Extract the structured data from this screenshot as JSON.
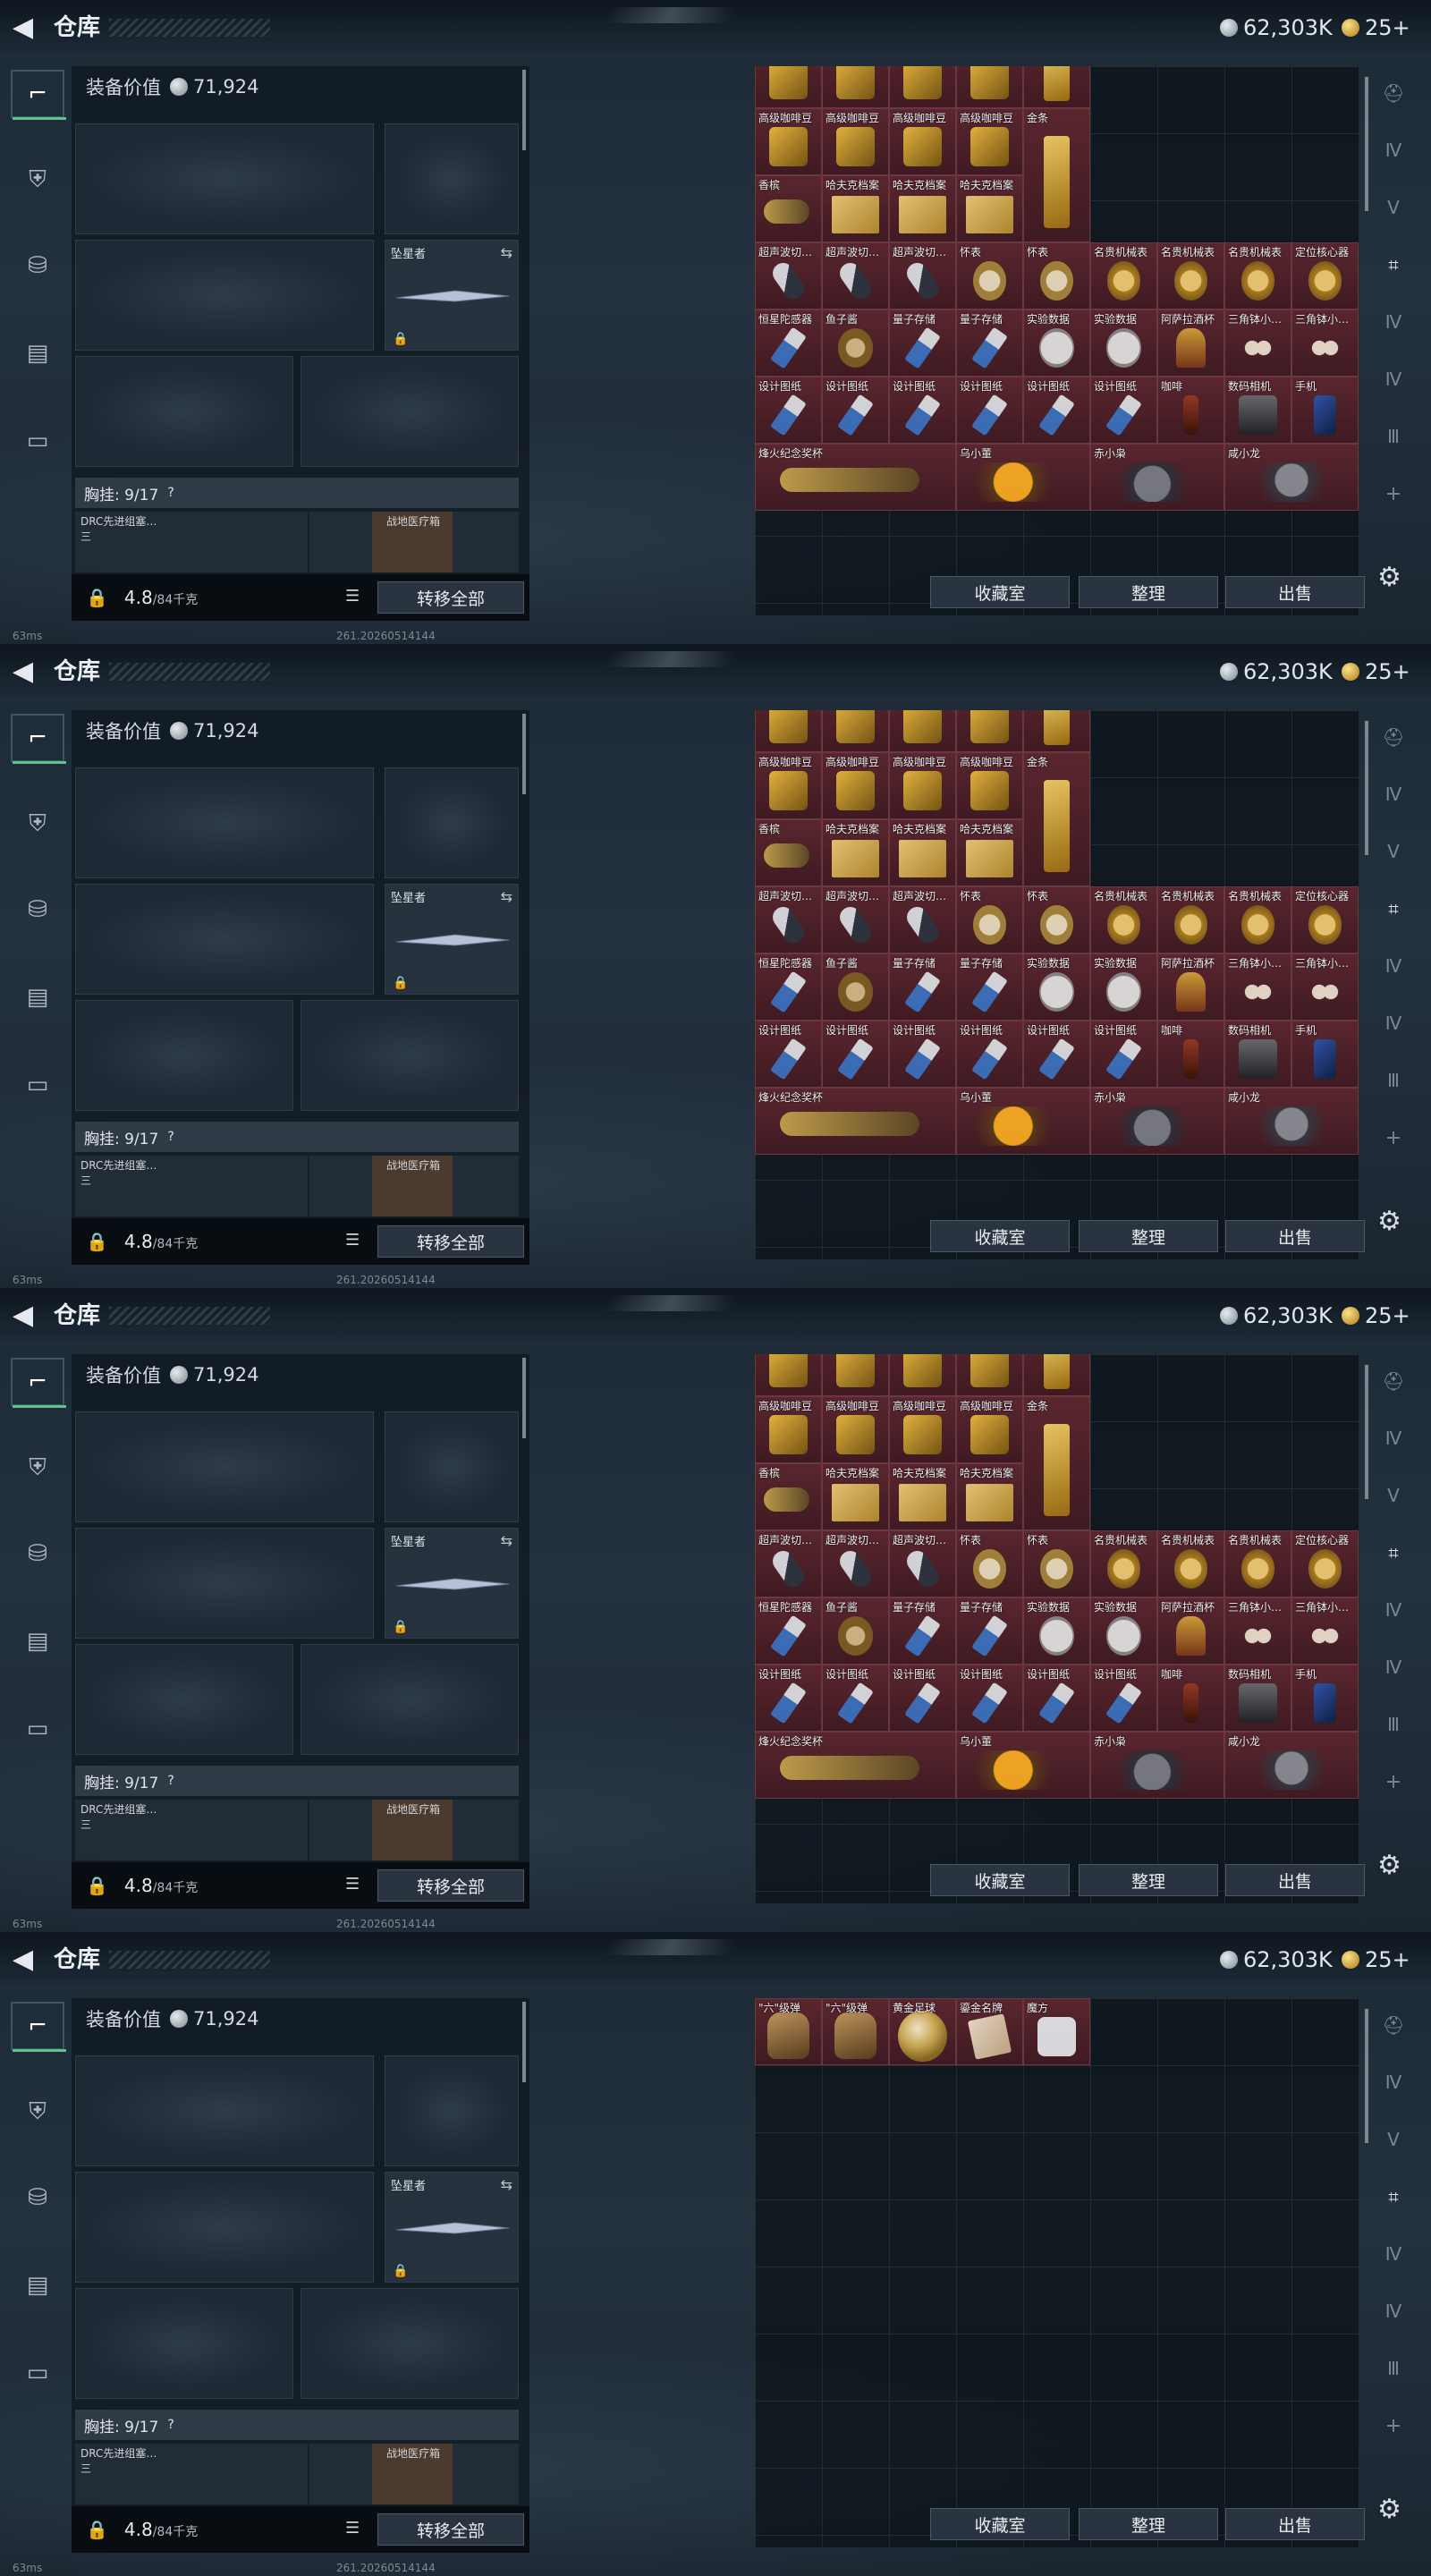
{
  "topbar": {
    "back_icon": "back-arrow-icon",
    "title": "仓库",
    "currency_silver": "62,303K",
    "currency_gold": "25+"
  },
  "equipment": {
    "value_label": "装备价值",
    "value": "71,924",
    "melee_name": "坠星者",
    "chest_label": "胸挂: 9/17",
    "chest_help": "?",
    "pouch1_line1": "DRC先进组塞…",
    "pouch1_line2": "三",
    "pouch2": "战地医疗箱",
    "weight": "4.8",
    "weight_max": "/84千克",
    "transfer_all": "转移全部"
  },
  "footer": {
    "ping": "63ms",
    "build": "261.20260514144"
  },
  "actions": {
    "collection": "收藏室",
    "sort": "整理",
    "sell": "出售"
  },
  "colors": {
    "item_bg": "#5a262e",
    "accent_green": "#5cc48a"
  },
  "sidebar_icons": [
    "weapon-icon",
    "armor-icon",
    "backpack-icon",
    "clipboard-icon",
    "briefcase-icon"
  ],
  "right_icons": [
    "helmet-icon",
    "tab-iv-icon",
    "tab-v-icon",
    "scan-icon",
    "tab-iv-b-icon",
    "tab-iv-c-icon",
    "tab-iii-icon",
    "plus-icon"
  ],
  "stash_page_a": [
    {
      "name": "高级咖啡豆",
      "art": "coffee",
      "c": 0,
      "r": 0,
      "w": 1,
      "h": 1
    },
    {
      "name": "高级咖啡豆",
      "art": "coffee",
      "c": 1,
      "r": 0,
      "w": 1,
      "h": 1
    },
    {
      "name": "高级咖啡豆",
      "art": "coffee",
      "c": 2,
      "r": 0,
      "w": 1,
      "h": 1
    },
    {
      "name": "高级咖啡豆",
      "art": "coffee",
      "c": 3,
      "r": 0,
      "w": 1,
      "h": 1
    },
    {
      "name": "",
      "art": "gold",
      "c": 4,
      "r": 0,
      "w": 1,
      "h": 1
    },
    {
      "name": "高级咖啡豆",
      "art": "coffee",
      "c": 0,
      "r": 1,
      "w": 1,
      "h": 1
    },
    {
      "name": "高级咖啡豆",
      "art": "coffee",
      "c": 1,
      "r": 1,
      "w": 1,
      "h": 1
    },
    {
      "name": "高级咖啡豆",
      "art": "coffee",
      "c": 2,
      "r": 1,
      "w": 1,
      "h": 1
    },
    {
      "name": "高级咖啡豆",
      "art": "coffee",
      "c": 3,
      "r": 1,
      "w": 1,
      "h": 1
    },
    {
      "name": "金条",
      "art": "gold",
      "c": 4,
      "r": 1,
      "w": 1,
      "h": 2
    },
    {
      "name": "香槟",
      "art": "champ",
      "c": 0,
      "r": 2,
      "w": 1,
      "h": 1
    },
    {
      "name": "哈夫克档案",
      "art": "paper",
      "c": 1,
      "r": 2,
      "w": 1,
      "h": 1
    },
    {
      "name": "哈夫克档案",
      "art": "paper",
      "c": 2,
      "r": 2,
      "w": 1,
      "h": 1
    },
    {
      "name": "哈夫克档案",
      "art": "paper",
      "c": 3,
      "r": 2,
      "w": 1,
      "h": 1
    },
    {
      "name": "超声波切…",
      "art": "pen",
      "c": 0,
      "r": 6,
      "w": 1,
      "h": 1
    },
    {
      "name": "超声波切…",
      "art": "pen",
      "c": 1,
      "r": 6,
      "w": 1,
      "h": 1
    },
    {
      "name": "超声波切…",
      "art": "pen",
      "c": 2,
      "r": 6,
      "w": 1,
      "h": 1
    },
    {
      "name": "怀表",
      "art": "pocket",
      "c": 3,
      "r": 6,
      "w": 1,
      "h": 1
    },
    {
      "name": "怀表",
      "art": "pocket",
      "c": 4,
      "r": 6,
      "w": 1,
      "h": 1
    },
    {
      "name": "名贵机械表",
      "art": "watch",
      "c": 5,
      "r": 6,
      "w": 1,
      "h": 1
    },
    {
      "name": "名贵机械表",
      "art": "watch",
      "c": 6,
      "r": 6,
      "w": 1,
      "h": 1
    },
    {
      "name": "名贵机械表",
      "art": "watch",
      "c": 7,
      "r": 6,
      "w": 1,
      "h": 1
    },
    {
      "name": "定位核心器",
      "art": "watch",
      "c": 8,
      "r": 6,
      "w": 1,
      "h": 1
    },
    {
      "name": "恒星陀感器",
      "art": "usb",
      "c": 0,
      "r": 7,
      "w": 1,
      "h": 1
    },
    {
      "name": "鱼子酱",
      "art": "compass",
      "c": 1,
      "r": 7,
      "w": 1,
      "h": 1
    },
    {
      "name": "量子存储",
      "art": "usb",
      "c": 2,
      "r": 7,
      "w": 1,
      "h": 1
    },
    {
      "name": "量子存储",
      "art": "usb",
      "c": 3,
      "r": 7,
      "w": 1,
      "h": 1
    },
    {
      "name": "实验数据",
      "art": "disc",
      "c": 4,
      "r": 7,
      "w": 1,
      "h": 1
    },
    {
      "name": "实验数据",
      "art": "disc",
      "c": 5,
      "r": 7,
      "w": 1,
      "h": 1
    },
    {
      "name": "阿萨拉酒杯",
      "art": "wine",
      "c": 6,
      "r": 7,
      "w": 1,
      "h": 1
    },
    {
      "name": "三角钵小…",
      "art": "eggs",
      "c": 7,
      "r": 7,
      "w": 1,
      "h": 1
    },
    {
      "name": "三角钵小…",
      "art": "eggs",
      "c": 8,
      "r": 7,
      "w": 1,
      "h": 1
    },
    {
      "name": "设计图纸",
      "art": "usb",
      "c": 0,
      "r": 8,
      "w": 1,
      "h": 1
    },
    {
      "name": "设计图纸",
      "art": "usb",
      "c": 1,
      "r": 8,
      "w": 1,
      "h": 1
    },
    {
      "name": "设计图纸",
      "art": "usb",
      "c": 2,
      "r": 8,
      "w": 1,
      "h": 1
    },
    {
      "name": "设计图纸",
      "art": "usb",
      "c": 3,
      "r": 8,
      "w": 1,
      "h": 1
    },
    {
      "name": "设计图纸",
      "art": "usb",
      "c": 4,
      "r": 8,
      "w": 1,
      "h": 1
    },
    {
      "name": "设计图纸",
      "art": "usb",
      "c": 5,
      "r": 8,
      "w": 1,
      "h": 1
    },
    {
      "name": "咖啡",
      "art": "coke",
      "c": 6,
      "r": 8,
      "w": 1,
      "h": 1
    },
    {
      "name": "数码相机",
      "art": "camera",
      "c": 7,
      "r": 8,
      "w": 1,
      "h": 1
    },
    {
      "name": "手机",
      "art": "phone",
      "c": 8,
      "r": 8,
      "w": 1,
      "h": 1
    },
    {
      "name": "烽火纪念奖杯",
      "art": "champ",
      "c": 0,
      "r": 9,
      "w": 3,
      "h": 1
    },
    {
      "name": "乌小董",
      "art": "bird",
      "c": 3,
      "r": 9,
      "w": 2,
      "h": 1
    },
    {
      "name": "赤小枭",
      "art": "mech",
      "c": 5,
      "r": 9,
      "w": 2,
      "h": 1
    },
    {
      "name": "咸小龙",
      "art": "owl",
      "c": 7,
      "r": 9,
      "w": 2,
      "h": 1
    }
  ],
  "stash_page_b": [
    {
      "name": "\"六\"级弹",
      "art": "hand",
      "c": 0,
      "r": 0,
      "w": 1,
      "h": 1
    },
    {
      "name": "\"六\"级弹",
      "art": "hand",
      "c": 1,
      "r": 0,
      "w": 1,
      "h": 1
    },
    {
      "name": "黄金足球",
      "art": "ball",
      "c": 2,
      "r": 0,
      "w": 1,
      "h": 1
    },
    {
      "name": "鎏金名牌",
      "art": "card",
      "c": 3,
      "r": 0,
      "w": 1,
      "h": 1
    },
    {
      "name": "魔方",
      "art": "dice",
      "c": 4,
      "r": 0,
      "w": 1,
      "h": 1
    }
  ]
}
